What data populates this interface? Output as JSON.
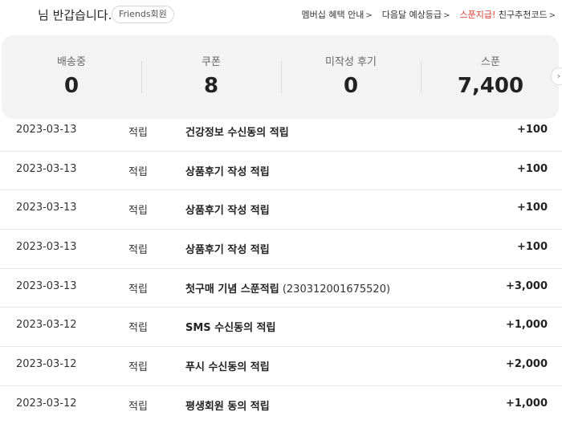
{
  "header": {
    "greeting": "님 반갑습니다.",
    "member_badge": "Friends회원",
    "links": [
      {
        "label": "멤버십 혜택 안내",
        "style": "dark"
      },
      {
        "label": "다음달 예상등급",
        "style": "dark"
      },
      {
        "label": "스푼지급!",
        "style": "red",
        "suffix": "친구추천코드"
      }
    ],
    "chevron": ">"
  },
  "summary": {
    "stats": [
      {
        "label": "배송중",
        "value": "0"
      },
      {
        "label": "쿠폰",
        "value": "8"
      },
      {
        "label": "미작성 후기",
        "value": "0"
      },
      {
        "label": "스푼",
        "value": "7,400"
      }
    ],
    "next": "›"
  },
  "history": [
    {
      "date": "2023-03-13",
      "type": "적립",
      "desc": "건강정보 수신동의 적립",
      "sub": "",
      "points": "+100"
    },
    {
      "date": "2023-03-13",
      "type": "적립",
      "desc": "상품후기 작성 적립",
      "sub": "",
      "points": "+100"
    },
    {
      "date": "2023-03-13",
      "type": "적립",
      "desc": "상품후기 작성 적립",
      "sub": "",
      "points": "+100"
    },
    {
      "date": "2023-03-13",
      "type": "적립",
      "desc": "상품후기 작성 적립",
      "sub": "",
      "points": "+100"
    },
    {
      "date": "2023-03-13",
      "type": "적립",
      "desc": "첫구매 기념 스푼적립",
      "sub": " (230312001675520)",
      "points": "+3,000"
    },
    {
      "date": "2023-03-12",
      "type": "적립",
      "desc": "SMS 수신동의 적립",
      "sub": "",
      "points": "+1,000"
    },
    {
      "date": "2023-03-12",
      "type": "적립",
      "desc": "푸시 수신동의 적립",
      "sub": "",
      "points": "+2,000"
    },
    {
      "date": "2023-03-12",
      "type": "적립",
      "desc": "평생회원 동의 적립",
      "sub": "",
      "points": "+1,000"
    }
  ]
}
